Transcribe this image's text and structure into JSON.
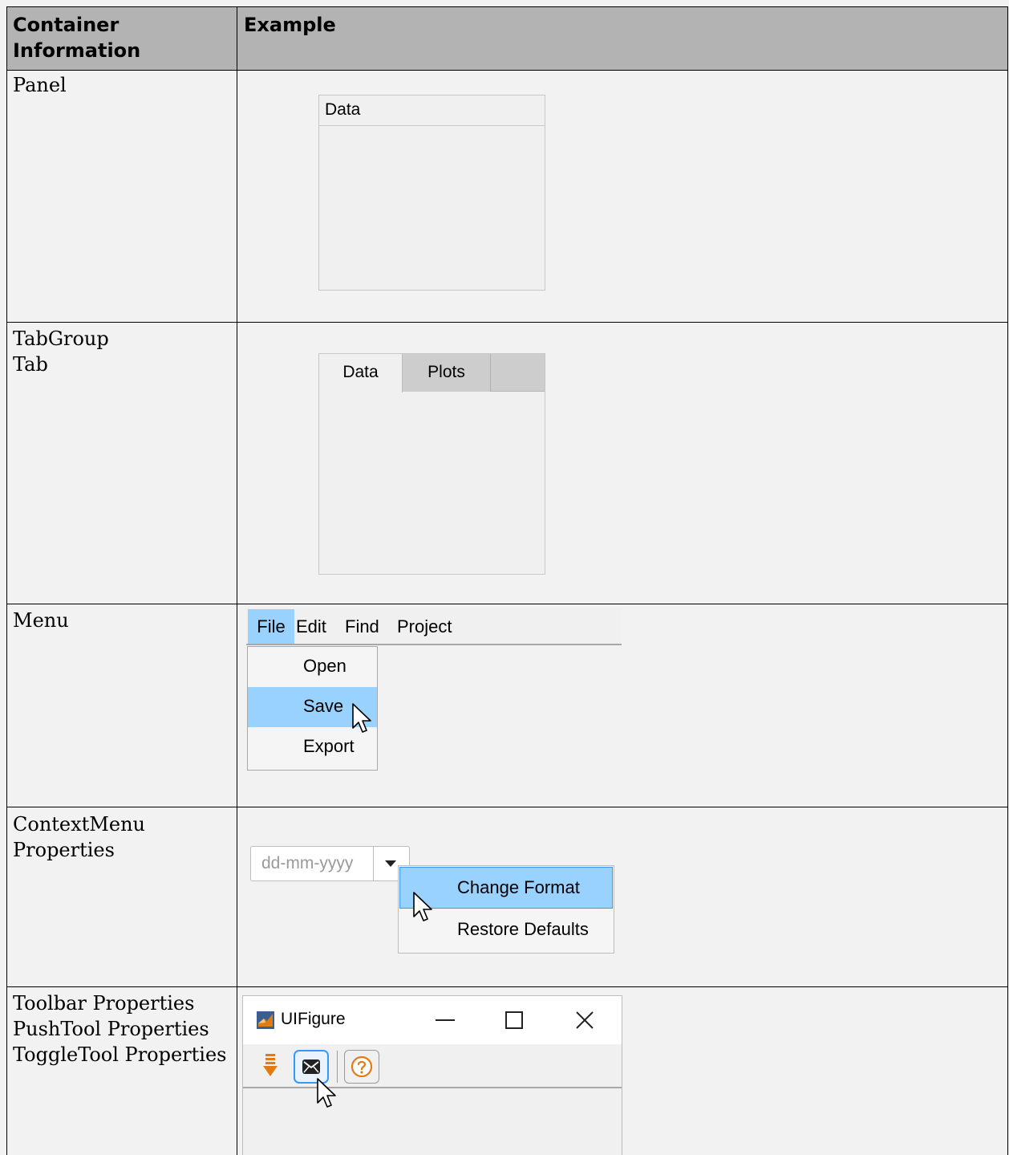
{
  "table": {
    "headers": [
      "Container\nInformation",
      "Example"
    ],
    "rows": [
      {
        "info": "Panel"
      },
      {
        "info": "TabGroup\nTab"
      },
      {
        "info": "Menu"
      },
      {
        "info": "ContextMenu\nProperties"
      },
      {
        "info": "Toolbar Properties\nPushTool Properties\nToggleTool Properties"
      }
    ]
  },
  "panel_example": {
    "title": "Data"
  },
  "tab_example": {
    "tabs": [
      "Data",
      "Plots"
    ]
  },
  "menu_example": {
    "menubar": [
      "File",
      "Edit",
      "Find",
      "Project"
    ],
    "items": [
      "Open",
      "Save",
      "Export"
    ],
    "highlighted": "Save"
  },
  "context_example": {
    "date_placeholder": "dd-mm-yyyy",
    "items": [
      "Change Format",
      "Restore Defaults"
    ],
    "highlighted": "Change Format"
  },
  "toolbar_example": {
    "window_title": "UIFigure",
    "tools": [
      "import-icon",
      "mail-icon",
      "help-icon"
    ]
  },
  "colors": {
    "header_bg": "#b3b3b3",
    "highlight": "#99d1ff",
    "highlight_border": "#3399ff",
    "tool_orange": "#e07b16"
  }
}
